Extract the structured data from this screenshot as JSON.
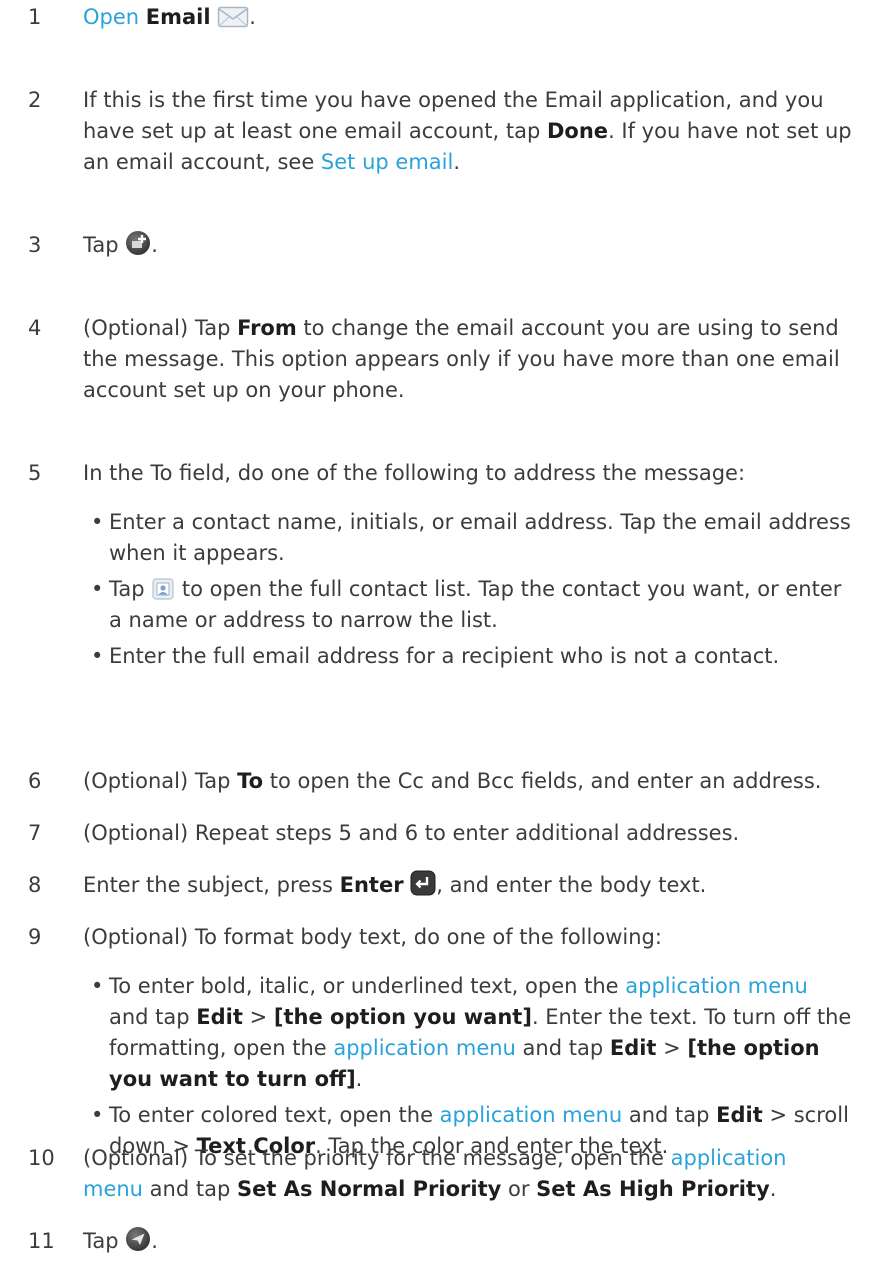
{
  "steps": [
    {
      "num": "1",
      "a": "Open",
      "b": "Email",
      "c": "."
    },
    {
      "num": "2",
      "a": "If this is the first time you have opened the Email application, and you have set up at least one email account, tap ",
      "b": "Done",
      "c": ". If you have not set up an email account, see ",
      "d": "Set up email",
      "e": "."
    },
    {
      "num": "3",
      "a": "Tap ",
      "c": "."
    },
    {
      "num": "4",
      "a": "(Optional) Tap ",
      "b": "From",
      "c": " to change the email account you are using to send the message. This option appears only if you have more than one email account set up on your phone."
    },
    {
      "num": "5",
      "a": "In the To field, do one of the following to address the message:",
      "bullets": [
        {
          "a": "Enter a contact name, initials, or email address. Tap the email address when it appears."
        },
        {
          "a": "Tap ",
          "c": " to open the full contact list. Tap the contact you want, or enter a name or address to narrow the list."
        },
        {
          "a": "Enter the full email address for a recipient who is not a contact."
        }
      ]
    },
    {
      "num": "6",
      "a": "(Optional) Tap ",
      "b": "To",
      "c": " to open the Cc and Bcc fields, and enter an address."
    },
    {
      "num": "7",
      "a": "(Optional) Repeat steps 5 and 6 to enter additional addresses."
    },
    {
      "num": "8",
      "a": "Enter the subject, press ",
      "b": "Enter",
      "c": ", and enter the body text."
    },
    {
      "num": "9",
      "a": "(Optional) To format body text, do one of the following:",
      "bullets": [
        {
          "a": "To enter bold, italic, or underlined text, open the ",
          "l1": "application menu",
          "b1": " and tap ",
          "k1": "Edit",
          "g1": " > ",
          "k2": "[the option you want]",
          "g2": ". Enter the text. To turn off the formatting, open the ",
          "l2": "application menu",
          "b2": " and tap ",
          "k3": "Edit",
          "g3": " > ",
          "k4": "[the option you want to turn off]",
          "g4": "."
        },
        {
          "a": "To enter colored text, open the ",
          "l1": "application menu",
          "b1": " and tap ",
          "k1": "Edit",
          "g1": " > scroll down > ",
          "k2": "Text Color",
          "g2": ". Tap the color and enter the text."
        }
      ]
    },
    {
      "num": "10",
      "a": "(Optional) To set the priority for the message, open the ",
      "l1": "application menu",
      "b1": " and tap ",
      "k1": "Set As Normal Priority",
      "g1": " or ",
      "k2": "Set As High Priority",
      "g2": "."
    },
    {
      "num": "11",
      "a": "Tap ",
      "c": "."
    }
  ],
  "icons": {
    "email": "envelope-icon",
    "compose": "compose-new-icon",
    "contacts": "contact-card-icon",
    "enter": "enter-key-icon",
    "send": "send-icon"
  },
  "colors": {
    "link": "#29a3d9",
    "text": "#3c3c3c"
  }
}
